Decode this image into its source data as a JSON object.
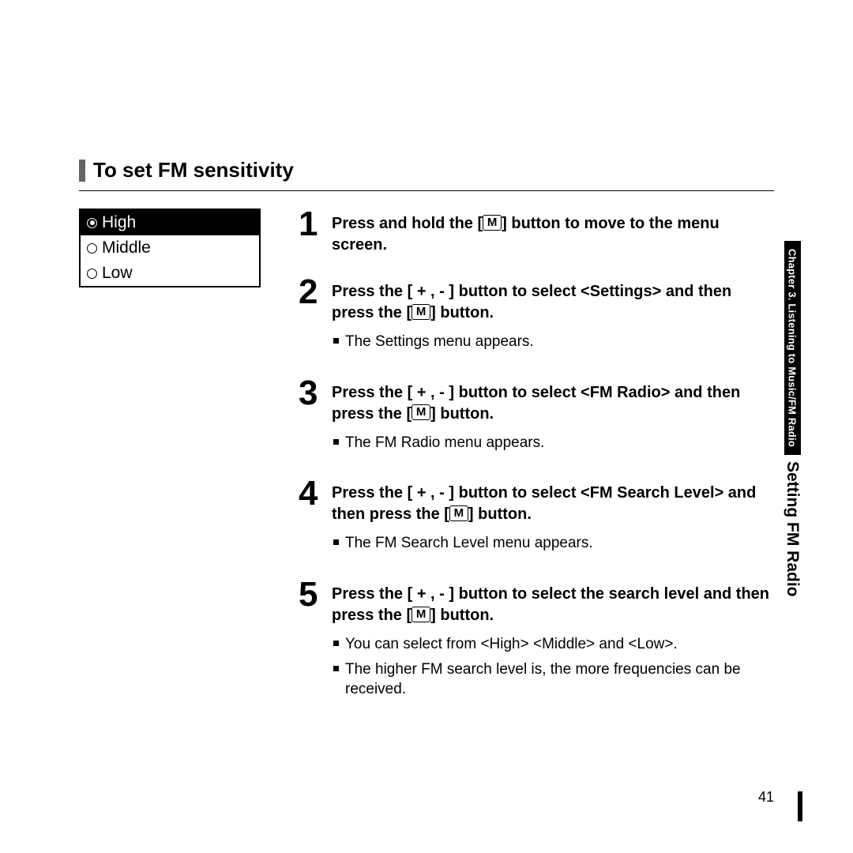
{
  "heading": "To set FM sensitivity",
  "device_menu": {
    "items": [
      {
        "label": "High",
        "selected": true
      },
      {
        "label": "Middle",
        "selected": false
      },
      {
        "label": "Low",
        "selected": false
      }
    ]
  },
  "m_glyph": "M",
  "steps": [
    {
      "num": "1",
      "main_pre": "Press and hold the [",
      "main_post": "] button to move to the menu screen.",
      "notes": []
    },
    {
      "num": "2",
      "main_pre": "Press the [ + , - ] button to select <Settings> and then press the [",
      "main_post": "] button.",
      "notes": [
        "The Settings menu appears."
      ]
    },
    {
      "num": "3",
      "main_pre": "Press the [ + , - ] button to select <FM Radio> and then press the [",
      "main_post": "] button.",
      "notes": [
        "The FM Radio menu appears."
      ]
    },
    {
      "num": "4",
      "main_pre": "Press the [ + , - ] button to select <FM Search Level> and then press the [",
      "main_post": "] button.",
      "notes": [
        "The FM Search Level menu appears."
      ]
    },
    {
      "num": "5",
      "main_pre": "Press the [ + , - ] button to select the search level and then press the [",
      "main_post": "] button.",
      "notes": [
        "You can select from <High> <Middle> and <Low>.",
        "The higher FM search level is, the more frequencies can be received."
      ]
    }
  ],
  "side": {
    "chapter": "Chapter 3.  Listening to Music/FM Radio",
    "section": "Setting FM Radio"
  },
  "page_number": "41"
}
